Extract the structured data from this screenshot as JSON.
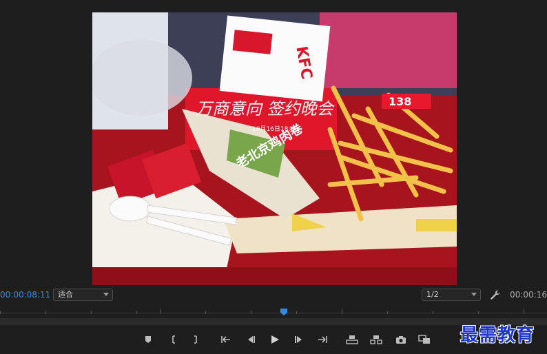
{
  "viewer": {
    "frame_caption": "万商意向 签约晚会",
    "frame_date": "10月16日18:00",
    "kfc_logo": "KFC",
    "wrap_label": "老北京鸡肉卷",
    "price_tag": "138"
  },
  "controls": {
    "timecode_current": "00:00:08:11",
    "fit_select": "适合",
    "resolution_select": "1/2",
    "timecode_duration": "00:00:16"
  },
  "watermark": "最需教育",
  "colors": {
    "timecode_accent": "#2d8ceb",
    "background": "#1e1e1e",
    "playhead": "#2d8ceb"
  }
}
